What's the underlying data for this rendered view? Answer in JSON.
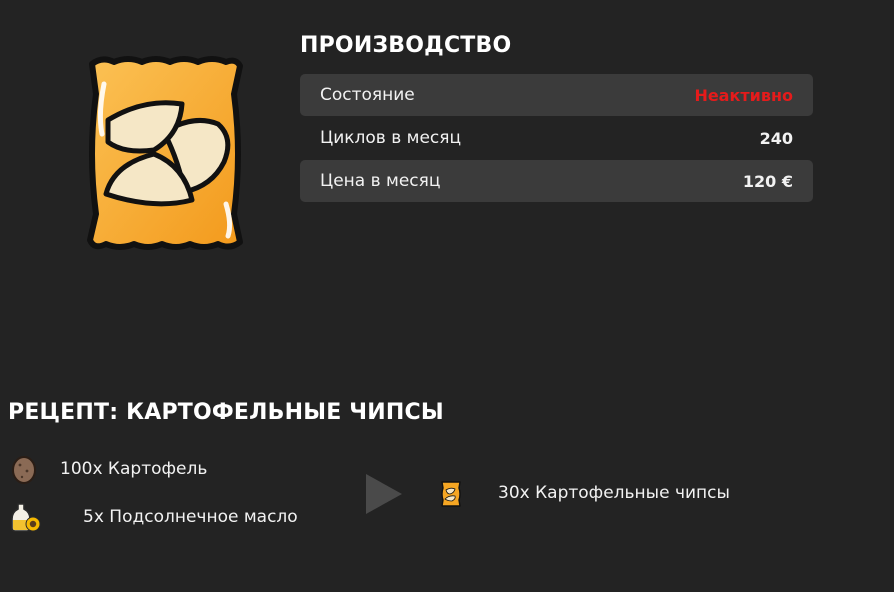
{
  "production": {
    "title": "ПРОИЗВОДСТВО",
    "rows": [
      {
        "label": "Состояние",
        "value": "Неактивно"
      },
      {
        "label": "Циклов в месяц",
        "value": "240"
      },
      {
        "label": "Цена в месяц",
        "value": "120 €"
      }
    ],
    "inactive_color": "#e51b1b"
  },
  "recipe": {
    "title": "РЕЦЕПТ: КАРТОФЕЛЬНЫЕ ЧИПСЫ",
    "inputs": [
      {
        "text": "100x Картофель",
        "icon": "potato-icon"
      },
      {
        "text": "5x Подсолнечное масло",
        "icon": "sunflower-oil-icon"
      }
    ],
    "output": {
      "text": "30x Картофельные чипсы",
      "icon": "chips-icon"
    }
  },
  "colors": {
    "background": "#232323",
    "row_shade": "#3b3b3b",
    "bag": "#f5a623"
  }
}
